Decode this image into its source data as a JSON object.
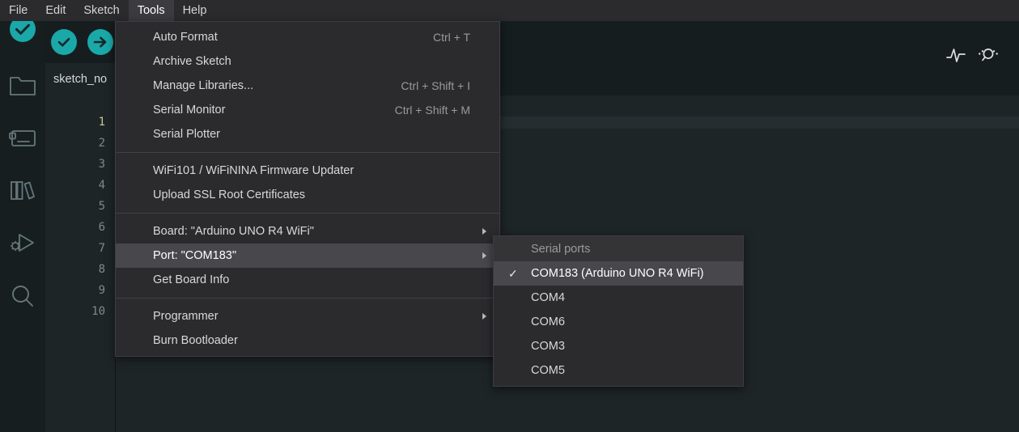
{
  "window": {
    "app_title": "Arduino IDE",
    "accent_color": "#1ba8a8",
    "menu_bg": "#2b2b2e",
    "highlight_color": "#48484c",
    "editor_bg": "#1e2527"
  },
  "menubar": {
    "items": [
      {
        "label": "File",
        "active": false
      },
      {
        "label": "Edit",
        "active": false
      },
      {
        "label": "Sketch",
        "active": false
      },
      {
        "label": "Tools",
        "active": true
      },
      {
        "label": "Help",
        "active": false
      }
    ]
  },
  "toolbar": {
    "verify_label": "Verify",
    "upload_label": "Upload",
    "debug_label": "Debug",
    "serial_plotter_label": "Serial Plotter",
    "serial_monitor_label": "Serial Monitor",
    "overflow_label": "•••"
  },
  "activitybar": {
    "items": [
      {
        "name": "verify-icon",
        "label": "Verify"
      },
      {
        "name": "sketchbook-icon",
        "label": "Sketchbook"
      },
      {
        "name": "boards-manager-icon",
        "label": "Boards Manager"
      },
      {
        "name": "library-manager-icon",
        "label": "Library Manager"
      },
      {
        "name": "debug-icon",
        "label": "Debug"
      },
      {
        "name": "search-icon",
        "label": "Search"
      }
    ]
  },
  "editor": {
    "tab_label": "sketch_no",
    "line_numbers": [
      "1",
      "2",
      "3",
      "4",
      "5",
      "6",
      "7",
      "8",
      "9",
      "10"
    ],
    "current_line": 1
  },
  "tools_menu": {
    "items": [
      {
        "label": "Auto Format",
        "accel": "Ctrl + T",
        "submenu": false,
        "highlight": false
      },
      {
        "label": "Archive Sketch",
        "accel": "",
        "submenu": false,
        "highlight": false
      },
      {
        "label": "Manage Libraries...",
        "accel": "Ctrl + Shift + I",
        "submenu": false,
        "highlight": false
      },
      {
        "label": "Serial Monitor",
        "accel": "Ctrl + Shift + M",
        "submenu": false,
        "highlight": false
      },
      {
        "label": "Serial Plotter",
        "accel": "",
        "submenu": false,
        "highlight": false
      },
      {
        "separator": true
      },
      {
        "label": "WiFi101 / WiFiNINA Firmware Updater",
        "accel": "",
        "submenu": false,
        "highlight": false
      },
      {
        "label": "Upload SSL Root Certificates",
        "accel": "",
        "submenu": false,
        "highlight": false
      },
      {
        "separator": true
      },
      {
        "label": "Board: \"Arduino UNO R4 WiFi\"",
        "accel": "",
        "submenu": true,
        "highlight": false
      },
      {
        "label": "Port: \"COM183\"",
        "accel": "",
        "submenu": true,
        "highlight": true
      },
      {
        "label": "Get Board Info",
        "accel": "",
        "submenu": false,
        "highlight": false
      },
      {
        "separator": true
      },
      {
        "label": "Programmer",
        "accel": "",
        "submenu": true,
        "highlight": false
      },
      {
        "label": "Burn Bootloader",
        "accel": "",
        "submenu": false,
        "highlight": false
      }
    ]
  },
  "port_submenu": {
    "header": "Serial ports",
    "check_glyph": "✓",
    "items": [
      {
        "label": "COM183 (Arduino UNO R4 WiFi)",
        "checked": true,
        "highlight": true
      },
      {
        "label": "COM4",
        "checked": false,
        "highlight": false
      },
      {
        "label": "COM6",
        "checked": false,
        "highlight": false
      },
      {
        "label": "COM3",
        "checked": false,
        "highlight": false
      },
      {
        "label": "COM5",
        "checked": false,
        "highlight": false
      }
    ]
  }
}
